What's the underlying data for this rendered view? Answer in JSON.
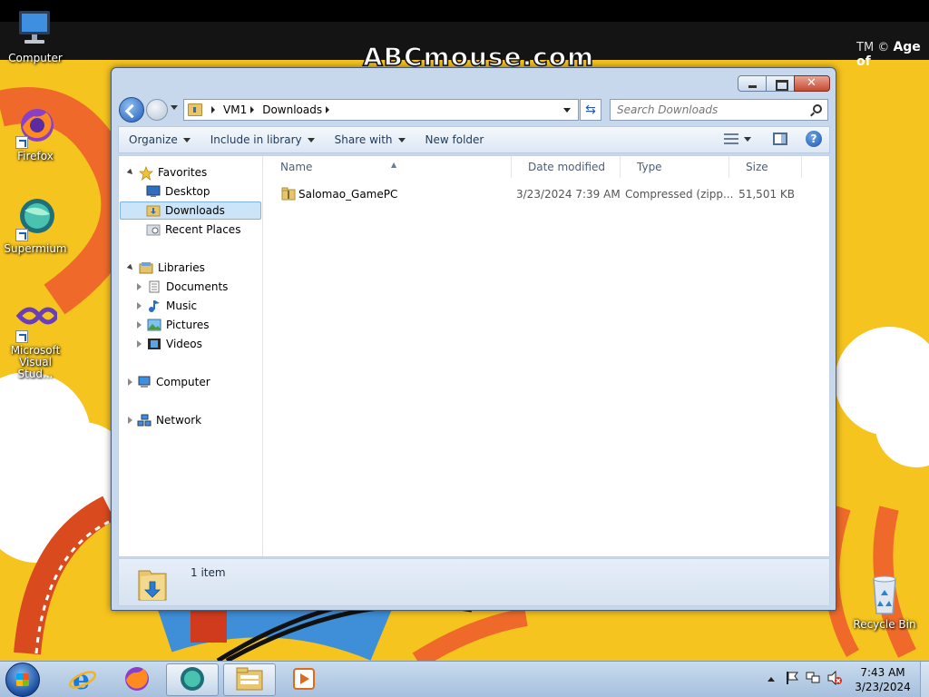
{
  "wallpaper": {
    "logo_text": "ABCmouse.com",
    "tm_text": "TM ©",
    "age_text": "Age of"
  },
  "desktop_icons": [
    {
      "label": "Computer"
    },
    {
      "label": "Firefox"
    },
    {
      "label": "Supermium"
    },
    {
      "label": "Microsoft Visual Stud..."
    },
    {
      "label": "Recycle Bin"
    }
  ],
  "explorer": {
    "breadcrumbs": [
      "VM1",
      "Downloads"
    ],
    "search_placeholder": "Search Downloads",
    "toolbar": {
      "organize": "Organize",
      "include_in_library": "Include in library",
      "share_with": "Share with",
      "new_folder": "New folder"
    },
    "nav": {
      "favorites": "Favorites",
      "desktop": "Desktop",
      "downloads": "Downloads",
      "recent_places": "Recent Places",
      "libraries": "Libraries",
      "documents": "Documents",
      "music": "Music",
      "pictures": "Pictures",
      "videos": "Videos",
      "computer": "Computer",
      "network": "Network"
    },
    "columns": {
      "name": "Name",
      "date_modified": "Date modified",
      "type": "Type",
      "size": "Size"
    },
    "files": [
      {
        "name": "Salomao_GamePC",
        "date_modified": "3/23/2024 7:39 AM",
        "type": "Compressed (zipp...",
        "size": "51,501 KB"
      }
    ],
    "status": {
      "item_count": "1 item"
    }
  },
  "taskbar": {
    "clock_time": "7:43 AM",
    "clock_date": "3/23/2024",
    "pinned": [
      "internet-explorer",
      "firefox",
      "supermium",
      "windows-explorer",
      "media-player"
    ]
  },
  "colors": {
    "wallpaper_yellow": "#f6c41f",
    "selection_blue": "#cce4f7",
    "window_frame": "#c7d8ec"
  }
}
